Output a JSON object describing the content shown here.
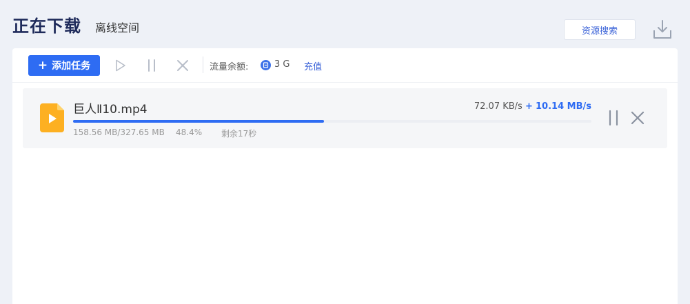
{
  "header": {
    "title": "正在下载",
    "subtitle": "离线空间",
    "search_label": "资源搜索"
  },
  "toolbar": {
    "add_label": "添加任务",
    "quota_label": "流量余额:",
    "quota_value": "3 G",
    "recharge_label": "充值"
  },
  "task": {
    "file_name": "巨人Ⅱ10.mp4",
    "speed": "72.07 KB/s",
    "speed_plus": "+",
    "accel_speed": "10.14 MB/s",
    "size_progress": "158.56 MB/327.65 MB",
    "percent": "48.4%",
    "progress": 0.484,
    "remaining": "剩余17秒"
  },
  "icons": {
    "add": "plus-icon",
    "start": "play-icon",
    "pause": "pause-icon",
    "delete": "close-icon",
    "quota": "coin-icon",
    "file": "video-file-icon",
    "download": "download-icon"
  },
  "colors": {
    "accent": "#2e6cf3",
    "link": "#3a62d8",
    "file_icon": "#fdb022",
    "title": "#1e2a5a"
  }
}
